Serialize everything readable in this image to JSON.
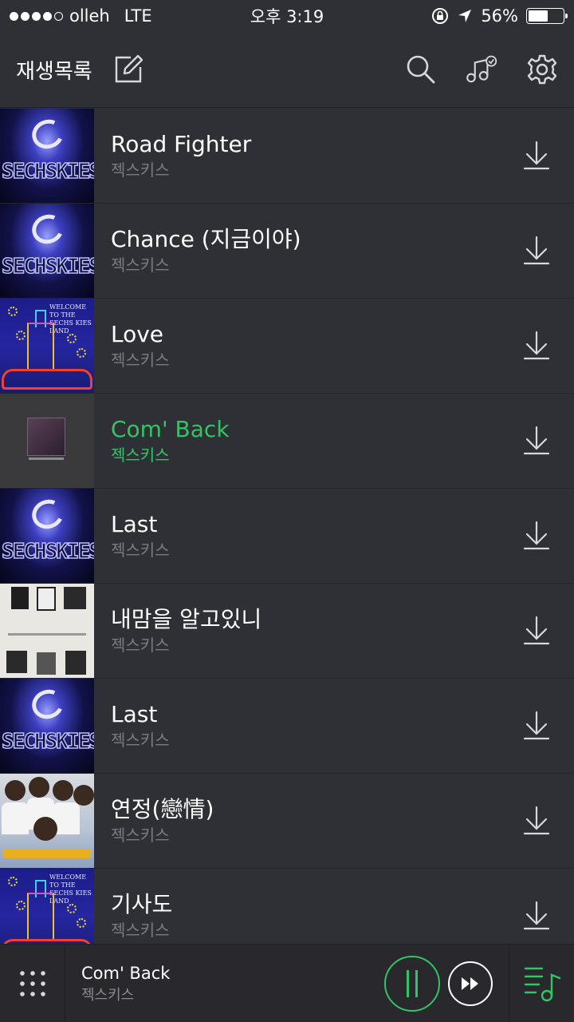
{
  "status_bar": {
    "carrier": "olleh",
    "network": "LTE",
    "time": "오후 3:19",
    "battery_text": "56%",
    "battery_level": 0.56
  },
  "header": {
    "title": "재생목록",
    "edit_icon": "edit-icon",
    "search_icon": "search-icon",
    "music_select_icon": "music-check-icon",
    "settings_icon": "gear-icon"
  },
  "tracks": [
    {
      "title": "Road Fighter",
      "artist": "젝스키스",
      "art": "sechs",
      "active": false
    },
    {
      "title": "Chance (지금이야)",
      "artist": "젝스키스",
      "art": "sechs",
      "active": false
    },
    {
      "title": "Love",
      "artist": "젝스키스",
      "art": "land",
      "active": false
    },
    {
      "title": "Com' Back",
      "artist": "젝스키스",
      "art": "comeback",
      "active": true
    },
    {
      "title": "Last",
      "artist": "젝스키스",
      "art": "sechs",
      "active": false
    },
    {
      "title": "내맘을 알고있니",
      "artist": "젝스키스",
      "art": "grid",
      "active": false
    },
    {
      "title": "Last",
      "artist": "젝스키스",
      "art": "sechs",
      "active": false
    },
    {
      "title": "연정(戀情)",
      "artist": "젝스키스",
      "art": "group",
      "active": false
    },
    {
      "title": "기사도",
      "artist": "젝스키스",
      "art": "land",
      "active": false
    }
  ],
  "album_art_text": {
    "sechs_logo": "SECHSKIES",
    "land_line1": "WELCOME",
    "land_line2": "TO THE",
    "land_line3": "SECHS KIES LAND"
  },
  "player": {
    "title": "Com' Back",
    "artist": "젝스키스",
    "state": "playing"
  },
  "colors": {
    "background": "#2f3035",
    "accent": "#33c463",
    "secondary_text": "#7a7b80"
  }
}
